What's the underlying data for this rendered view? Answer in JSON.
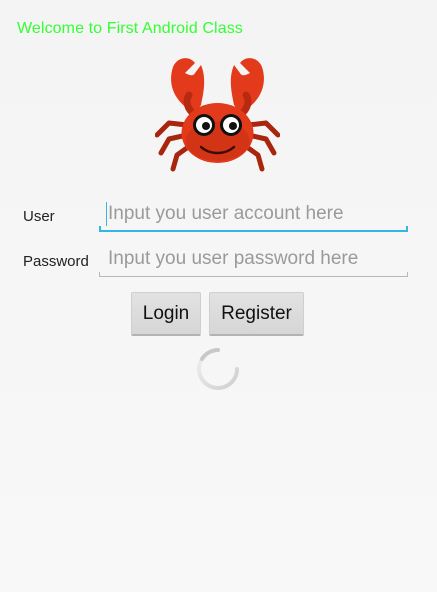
{
  "welcome_text": "Welcome to First Android Class",
  "colors": {
    "welcome": "#33ff33",
    "accent": "#33b5e5",
    "crab_body": "#e23a1b"
  },
  "logo": {
    "icon": "crab-logo-icon"
  },
  "form": {
    "user_label": "User",
    "user_placeholder": "Input you user account here",
    "user_value": "",
    "password_label": "Password",
    "password_placeholder": "Input you user password here",
    "password_value": ""
  },
  "buttons": {
    "login": "Login",
    "register": "Register"
  },
  "loading": {
    "icon": "progress-spinner-icon"
  }
}
